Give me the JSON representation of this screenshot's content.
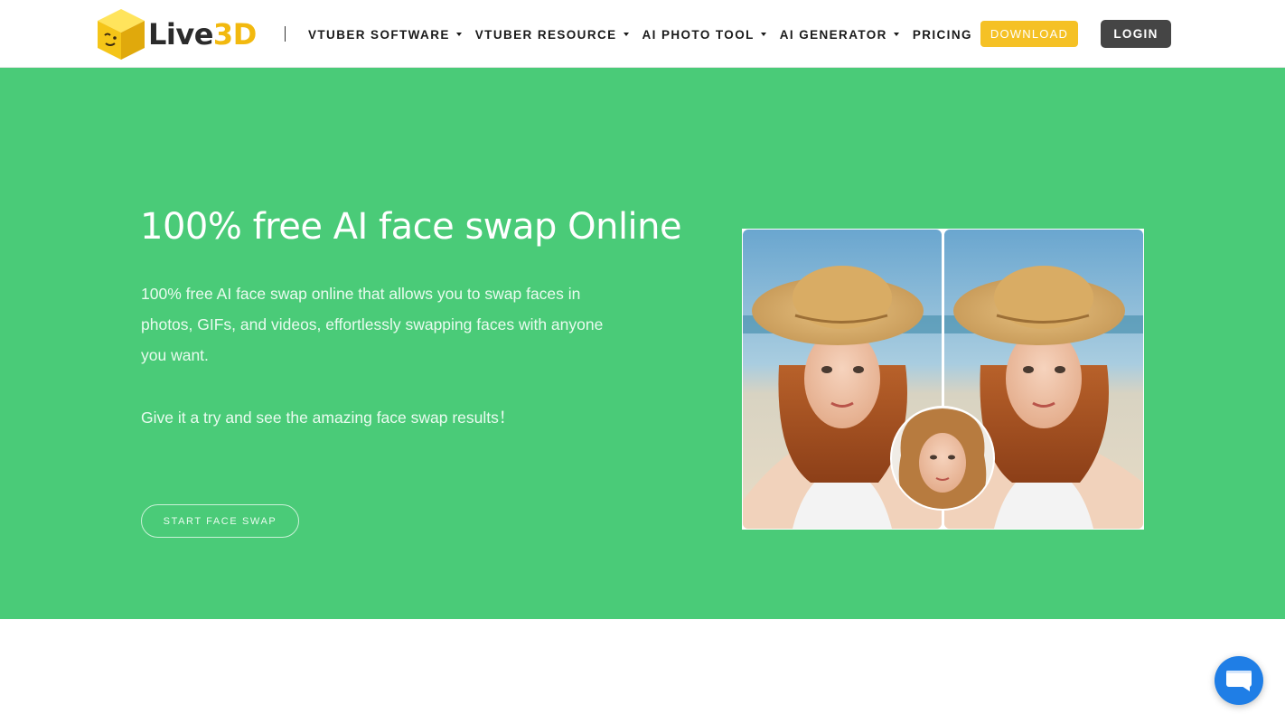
{
  "navbar": {
    "logo_text_main": "Live",
    "logo_text_accent": "3D",
    "items": [
      {
        "label": "VTUBER SOFTWARE",
        "has_dropdown": true
      },
      {
        "label": "VTUBER RESOURCE",
        "has_dropdown": true
      },
      {
        "label": "AI PHOTO TOOL",
        "has_dropdown": true
      },
      {
        "label": "AI GENERATOR",
        "has_dropdown": true
      },
      {
        "label": "PRICING",
        "has_dropdown": false
      }
    ],
    "download_label": "DOWNLOAD",
    "login_label": "LOGIN"
  },
  "hero": {
    "title": "100% free AI face swap Online",
    "description": "100% free AI face swap online that allows you to swap faces in photos, GIFs, and videos, effortlessly swapping faces with anyone you want.",
    "try_text": "Give it a try and see the amazing face swap results！",
    "start_label": "START FACE SWAP"
  },
  "colors": {
    "hero_bg": "#4acb78",
    "download_bg": "#f5c125",
    "login_bg": "#454545",
    "chat_bg": "#1f7ee6",
    "logo_accent": "#f2b90f"
  },
  "icons": {
    "logo": "yellow-cube-logo-icon",
    "chat": "chat-bubble-icon",
    "dropdown": "caret-down-icon"
  }
}
